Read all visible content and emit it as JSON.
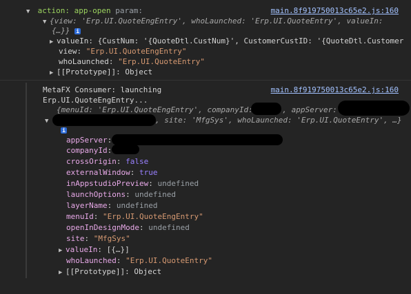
{
  "entry1": {
    "label": "action: app-open",
    "label_suffix": " param:",
    "source_link": "main.8f919750013c65e2.js:160",
    "summary": "{view: 'Erp.UI.QuoteEngEntry', whoLaunched: 'Erp.UI.QuoteEntry', valueIn:",
    "summary_cont": "{…}}",
    "props": [
      {
        "key": "valueIn",
        "value": "{CustNum: '{QuoteDtl.CustNum}', CustomerCustID: '{QuoteDtl.Customer",
        "expandable": true
      },
      {
        "key": "view",
        "value": "\"Erp.UI.QuoteEngEntry\"",
        "expandable": false
      },
      {
        "key": "whoLaunched",
        "value": "\"Erp.UI.QuoteEntry\"",
        "expandable": false
      },
      {
        "key": "[[Prototype]]",
        "value": "Object",
        "expandable": true
      }
    ]
  },
  "entry2": {
    "message_line1": "MetaFX Consumer: launching",
    "message_line2": "Erp.UI.QuoteEngEntry...",
    "source_link": "main.8f919750013c65e2.js:160",
    "summary_line1_a": "{menuId: 'Erp.UI.QuoteEngEntry', companyId: ",
    "summary_line1_b": ", appServer: ",
    "summary_line2": ", site: 'MfgSys', whoLaunched: 'Erp.UI.QuoteEntry', …}",
    "props": [
      {
        "key": "appServer",
        "value": "",
        "type": "redacted"
      },
      {
        "key": "companyId",
        "value": "",
        "type": "redacted"
      },
      {
        "key": "crossOrigin",
        "value": "false",
        "type": "bool"
      },
      {
        "key": "externalWindow",
        "value": "true",
        "type": "bool"
      },
      {
        "key": "inAppstudioPreview",
        "value": "undefined",
        "type": "undef"
      },
      {
        "key": "launchOptions",
        "value": "undefined",
        "type": "undef"
      },
      {
        "key": "layerName",
        "value": "undefined",
        "type": "undef"
      },
      {
        "key": "menuId",
        "value": "\"Erp.UI.QuoteEngEntry\"",
        "type": "string"
      },
      {
        "key": "openInDesignMode",
        "value": "undefined",
        "type": "undef"
      },
      {
        "key": "site",
        "value": "\"MfgSys\"",
        "type": "string"
      },
      {
        "key": "valueIn",
        "value": "[{…}]",
        "type": "object"
      },
      {
        "key": "whoLaunched",
        "value": "\"Erp.UI.QuoteEntry\"",
        "type": "string"
      },
      {
        "key": "[[Prototype]]",
        "value": "Object",
        "type": "object"
      }
    ]
  },
  "icons": {
    "info": "info-icon",
    "expanded": "triangle-down-icon",
    "collapsed": "triangle-right-icon"
  }
}
